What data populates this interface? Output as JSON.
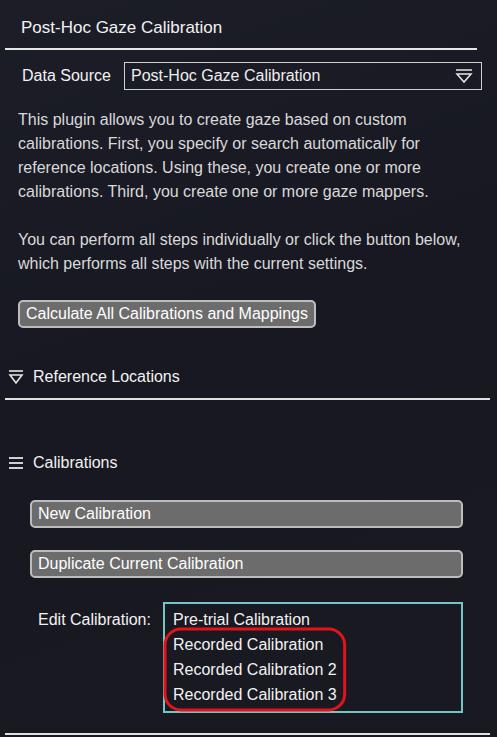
{
  "panel": {
    "title": "Post-Hoc Gaze Calibration"
  },
  "data_source": {
    "label": "Data Source",
    "value": "Post-Hoc Gaze Calibration"
  },
  "description": [
    "This plugin allows you to create gaze based on custom calibrations. First, you specify or search automatically for reference locations. Using these, you create one or more calibrations. Third, you create one or more gaze mappers.",
    "You can perform all steps individually or click the button below, which performs all steps with the current settings."
  ],
  "calculate_button": "Calculate All Calibrations and Mappings",
  "sections": [
    {
      "title": "Reference Locations",
      "expanded": false
    },
    {
      "title": "Calibrations",
      "expanded": true,
      "buttons": [
        "New Calibration",
        "Duplicate Current Calibration"
      ],
      "edit_label": "Edit Calibration:",
      "options": [
        {
          "label": "Pre-trial Calibration",
          "selected": false,
          "annotated": false
        },
        {
          "label": "Recorded Calibration",
          "selected": false,
          "annotated": true
        },
        {
          "label": "Recorded Calibration 2",
          "selected": false,
          "annotated": true
        },
        {
          "label": "Recorded Calibration 3",
          "selected": false,
          "annotated": true
        }
      ]
    }
  ]
}
